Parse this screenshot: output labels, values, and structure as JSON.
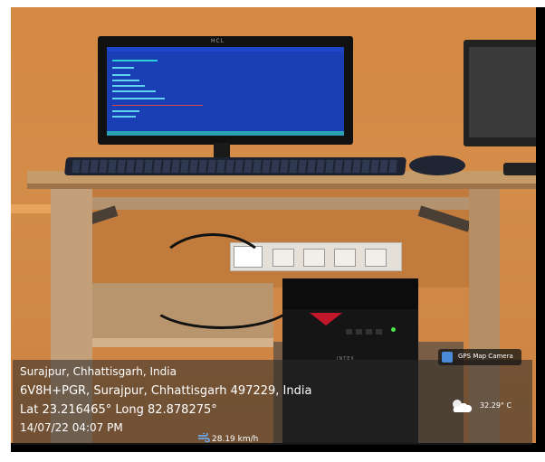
{
  "photo": {
    "monitor_brand": "HCL",
    "cpu_brand": "INTEX"
  },
  "overlay": {
    "location": "Surajpur, Chhattisgarh, India",
    "address": "6V8H+PGR, Surajpur, Chhattisgarh 497229, India",
    "coordinates": "Lat 23.216465° Long 82.878275°",
    "datetime": "14/07/22 04:07 PM",
    "speed": "28.19 km/h",
    "app_badge": "GPS Map Camera",
    "temperature": "32.29° C"
  },
  "icons": {
    "wind": "wind-icon",
    "weather": "partly-cloudy-icon",
    "app": "gps-map-camera-icon"
  },
  "colors": {
    "wall": "#d58a43",
    "screen": "#1a3fb4",
    "cpu_accent": "#c2162a"
  }
}
